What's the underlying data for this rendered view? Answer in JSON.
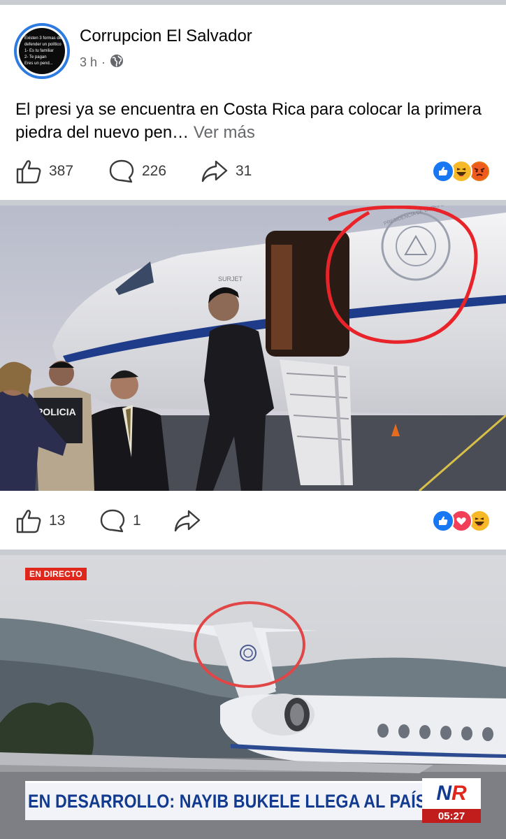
{
  "post": {
    "page_name": "Corrupcion El Salvador",
    "time": "3 h",
    "meta_sep": "·",
    "privacy_icon": "globe-icon",
    "avatar_lines": [
      "Existen 3 formas de",
      "defender un político",
      "1- Es tu familiar",
      "2- Te pagan",
      "Eres un pend..."
    ],
    "text": "El presi ya se encuentra en Costa Rica para colocar la primera piedra del nuevo pen…",
    "see_more": "Ver más"
  },
  "post_actions": {
    "likes": "387",
    "comments": "226",
    "shares": "31",
    "reactions": [
      "like",
      "haha",
      "angry"
    ]
  },
  "photo1": {
    "plane_text": "SURJET",
    "seal_text": "PRESIDENCIA DE LA REPÚBLICA · EL SALVADOR",
    "vest_text": "POLICIA",
    "annotation_color": "#e8242a"
  },
  "photo1_actions": {
    "likes": "13",
    "comments": "1",
    "reactions": [
      "like",
      "love",
      "haha"
    ]
  },
  "photo2": {
    "live_badge": "EN DIRECTO",
    "ticker": "EN DESARROLLO: NAYIB BUKELE LLEGA AL PAÍS",
    "logo_n": "N",
    "logo_r": "R",
    "clock": "05:27",
    "annotation_color": "#e04646"
  }
}
